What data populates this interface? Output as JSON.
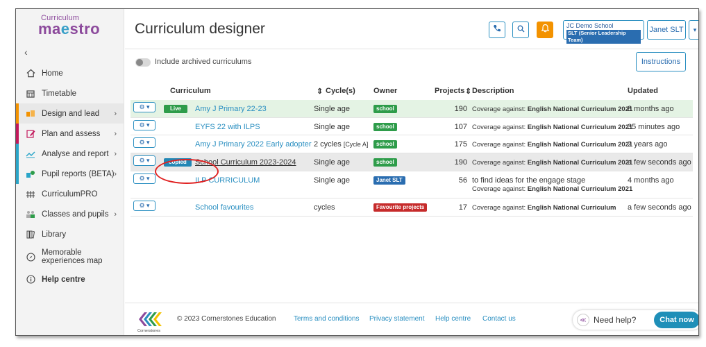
{
  "app": {
    "logo_small": "Curriculum",
    "logo_big_1": "ma",
    "logo_big_o": "e",
    "logo_big_2": "stro"
  },
  "sidebar": {
    "collapse": "‹",
    "items": [
      {
        "label": "Home",
        "icon": "home-icon"
      },
      {
        "label": "Timetable",
        "icon": "calendar-icon"
      },
      {
        "label": "Design and lead",
        "icon": "design-icon",
        "chevron": "›"
      },
      {
        "label": "Plan and assess",
        "icon": "pencil-icon",
        "chevron": "›"
      },
      {
        "label": "Analyse and report",
        "icon": "chart-icon",
        "chevron": "›"
      },
      {
        "label": "Pupil reports (BETA)",
        "icon": "report-icon",
        "chevron": "›"
      },
      {
        "label": "CurriculumPRO",
        "icon": "pro-icon"
      },
      {
        "label": "Classes and pupils",
        "icon": "users-icon",
        "chevron": "›"
      },
      {
        "label": "Library",
        "icon": "library-icon"
      },
      {
        "label": "Memorable experiences map",
        "icon": "compass-icon"
      },
      {
        "label": "Help centre",
        "icon": "info-icon"
      }
    ]
  },
  "header": {
    "title": "Curriculum designer",
    "school_name": "JC Demo School",
    "school_role": "SLT (Senior Leadership Team)",
    "user": "Janet SLT",
    "dropdown": "▾"
  },
  "toolbar": {
    "archived_label": "Include archived curriculums",
    "instructions": "Instructions"
  },
  "table": {
    "headers": {
      "curriculum": "Curriculum",
      "cycles": "Cycle(s)",
      "owner": "Owner",
      "projects": "Projects",
      "description": "Description",
      "updated": "Updated"
    },
    "rows": [
      {
        "badge": "Live",
        "name": "Amy J Primary 22-23",
        "cycle": "Single age",
        "cycle_extra": "",
        "owner": "school",
        "projects": "190",
        "desc_prefix": "Coverage against: ",
        "desc_bold": "English National Curriculum 2021",
        "desc_line1": "",
        "updated": "8 months ago"
      },
      {
        "badge": "",
        "name": "EYFS 22 with ILPS",
        "cycle": "Single age",
        "cycle_extra": "",
        "owner": "school",
        "projects": "107",
        "desc_prefix": "Coverage against: ",
        "desc_bold": "English National Curriculum 2021",
        "desc_line1": "",
        "updated": "35 minutes ago"
      },
      {
        "badge": "",
        "name": "Amy J Primary 2022 Early adopter",
        "cycle": "2 cycles",
        "cycle_extra": "[Cycle A]",
        "owner": "school",
        "projects": "175",
        "desc_prefix": "Coverage against: ",
        "desc_bold": "English National Curriculum 2021",
        "desc_line1": "",
        "updated": "2 years ago"
      },
      {
        "badge": "copied",
        "name": "School Curriculum 2023-2024",
        "cycle": "Single age",
        "cycle_extra": "",
        "owner": "school",
        "projects": "190",
        "desc_prefix": "Coverage against: ",
        "desc_bold": "English National Curriculum 2021",
        "desc_line1": "",
        "updated": "a few seconds ago"
      },
      {
        "badge": "",
        "name": "ILP CURRICULUM",
        "cycle": "Single age",
        "cycle_extra": "",
        "owner": "Janet SLT",
        "projects": "56",
        "desc_prefix": "Coverage against: ",
        "desc_bold": "English National Curriculum 2021",
        "desc_line1": "to find ideas for the engage stage",
        "updated": "4 months ago"
      },
      {
        "badge": "",
        "name": "School favourites",
        "cycle": "cycles",
        "cycle_extra": "",
        "owner": "Favourite projects",
        "projects": "17",
        "desc_prefix": "Coverage against: ",
        "desc_bold": "English National Curriculum",
        "desc_line1": "",
        "updated": "a few seconds ago"
      }
    ]
  },
  "footer": {
    "brand": "Cornerstones",
    "copyright": "© 2023 Cornerstones Education",
    "terms": "Terms and conditions",
    "privacy": "Privacy statement",
    "help": "Help centre",
    "contact": "Contact us",
    "need_help": "Need help?",
    "chat": "Chat now"
  },
  "colors": {
    "accent": "#2a8fc1",
    "live": "#2e9c4a",
    "copied": "#2287b5",
    "highlight": "#e02020"
  }
}
